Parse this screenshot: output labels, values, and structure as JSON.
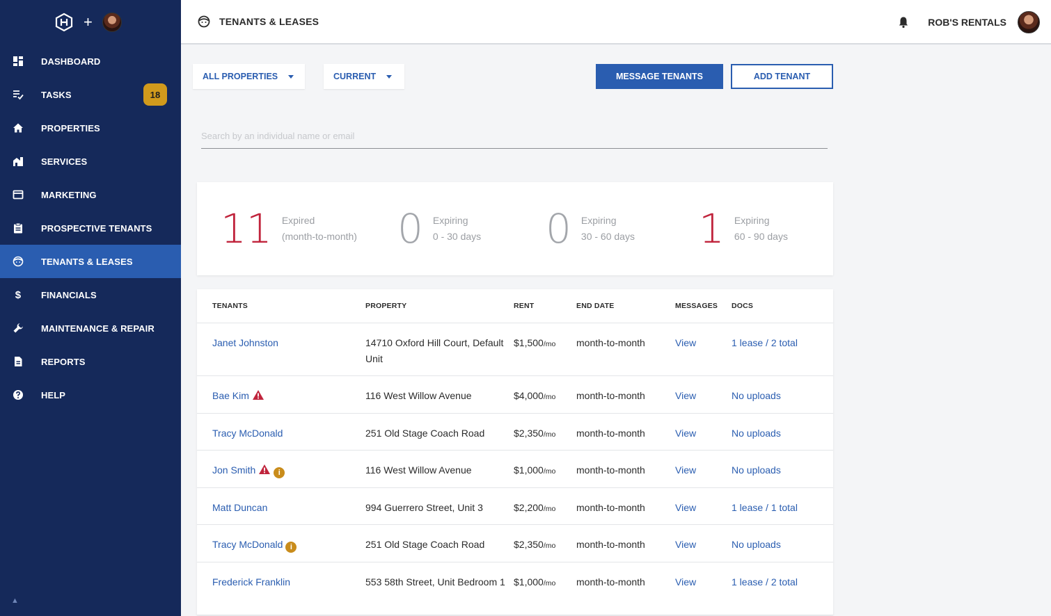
{
  "sidebar": {
    "items": [
      {
        "label": "DASHBOARD",
        "icon": "dashboard-icon"
      },
      {
        "label": "TASKS",
        "icon": "tasks-icon",
        "badge": "18"
      },
      {
        "label": "PROPERTIES",
        "icon": "home-icon"
      },
      {
        "label": "SERVICES",
        "icon": "services-icon"
      },
      {
        "label": "MARKETING",
        "icon": "marketing-icon"
      },
      {
        "label": "PROSPECTIVE TENANTS",
        "icon": "clipboard-icon"
      },
      {
        "label": "TENANTS & LEASES",
        "icon": "tenant-face-icon",
        "active": true
      },
      {
        "label": "FINANCIALS",
        "icon": "dollar-icon"
      },
      {
        "label": "MAINTENANCE & REPAIR",
        "icon": "wrench-icon"
      },
      {
        "label": "REPORTS",
        "icon": "document-icon"
      },
      {
        "label": "HELP",
        "icon": "help-icon"
      }
    ],
    "plus": "+"
  },
  "header": {
    "title": "TENANTS & LEASES",
    "account": "ROB'S RENTALS"
  },
  "controls": {
    "property_filter": "ALL PROPERTIES",
    "status_filter": "CURRENT",
    "message_button": "MESSAGE TENANTS",
    "add_button": "ADD TENANT",
    "search_placeholder": "Search by an individual name or email"
  },
  "stats": [
    {
      "value": "11",
      "line1": "Expired",
      "line2": "(month-to-month)",
      "color": "#c0243c"
    },
    {
      "value": "0",
      "line1": "Expiring",
      "line2": "0 - 30 days",
      "color": "#a3a6ab"
    },
    {
      "value": "0",
      "line1": "Expiring",
      "line2": "30 - 60 days",
      "color": "#a3a6ab"
    },
    {
      "value": "1",
      "line1": "Expiring",
      "line2": "60 - 90 days",
      "color": "#c0243c"
    }
  ],
  "table": {
    "headers": {
      "tenants": "TENANTS",
      "property": "PROPERTY",
      "rent": "RENT",
      "end_date": "END DATE",
      "messages": "MESSAGES",
      "docs": "DOCS"
    },
    "rent_unit": "/mo",
    "rows": [
      {
        "tenant": "Janet Johnston",
        "property": "14710 Oxford Hill Court, Default Unit",
        "rent": "$1,500",
        "end_date": "month-to-month",
        "messages": "View",
        "docs": "1 lease / 2 total",
        "warning": false,
        "info": false
      },
      {
        "tenant": "Bae Kim",
        "property": "116 West Willow Avenue",
        "rent": "$4,000",
        "end_date": "month-to-month",
        "messages": "View",
        "docs": "No uploads",
        "warning": true,
        "info": false
      },
      {
        "tenant": "Tracy McDonald",
        "property": "251 Old Stage Coach Road",
        "rent": "$2,350",
        "end_date": "month-to-month",
        "messages": "View",
        "docs": "No uploads",
        "warning": false,
        "info": false
      },
      {
        "tenant": "Jon Smith",
        "property": "116 West Willow Avenue",
        "rent": "$1,000",
        "end_date": "month-to-month",
        "messages": "View",
        "docs": "No uploads",
        "warning": true,
        "info": true
      },
      {
        "tenant": "Matt Duncan",
        "property": "994 Guerrero Street, Unit 3",
        "rent": "$2,200",
        "end_date": "month-to-month",
        "messages": "View",
        "docs": "1 lease / 1 total",
        "warning": false,
        "info": false
      },
      {
        "tenant": "Tracy McDonald",
        "property": "251 Old Stage Coach Road",
        "rent": "$2,350",
        "end_date": "month-to-month",
        "messages": "View",
        "docs": "No uploads",
        "warning": false,
        "info": true
      },
      {
        "tenant": "Frederick Franklin",
        "property": "553 58th Street, Unit Bedroom 1",
        "rent": "$1,000",
        "end_date": "month-to-month",
        "messages": "View",
        "docs": "1 lease / 2 total",
        "warning": false,
        "info": false
      }
    ]
  },
  "colors": {
    "sidebar": "#15295a",
    "accent": "#2a5db0",
    "alert": "#c0243c",
    "badge": "#d19a1c"
  }
}
